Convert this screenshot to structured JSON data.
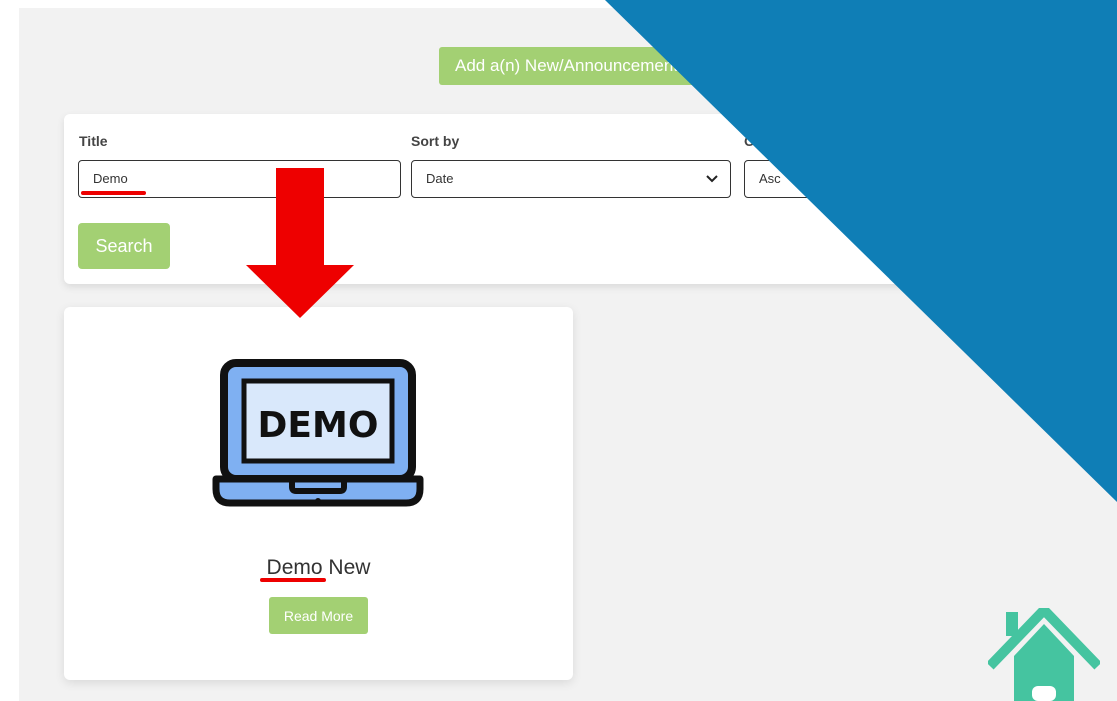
{
  "header": {
    "add_button_label": "Add a(n) New/Announcement"
  },
  "filters": {
    "title_label": "Title",
    "title_value": "Demo",
    "sort_label": "Sort by",
    "sort_value": "Date",
    "order_label": "Or",
    "order_value": "Asc",
    "search_label": "Search"
  },
  "result": {
    "thumbnail_text": "DEMO",
    "title_highlight": "Demo",
    "title_rest": " New",
    "read_more_label": "Read More"
  },
  "colors": {
    "accent_green": "#a3d073",
    "highlight_red": "#ee0000",
    "brand_blue": "#0f7eb6",
    "home_green": "#45c4a0",
    "laptop_screen": "#7fb0f2"
  },
  "icons": [
    "down-arrow-icon",
    "laptop-demo-icon",
    "chevron-down-icon",
    "home-icon"
  ]
}
